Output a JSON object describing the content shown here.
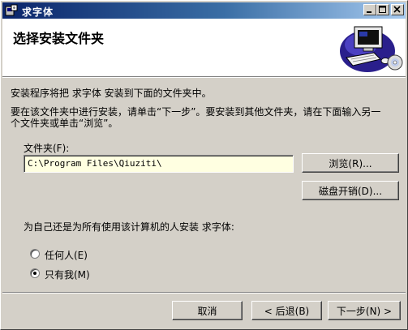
{
  "window": {
    "title": "求字体",
    "icons": {
      "app": "setup-app-icon",
      "minimize": "minimize-icon",
      "maximize": "maximize-icon",
      "close": "close-icon"
    }
  },
  "banner": {
    "title": "选择安装文件夹",
    "image": "computer-with-disc-illustration"
  },
  "body": {
    "intro": "安装程序将把 求字体 安装到下面的文件夹中。",
    "instruction_line1": "要在该文件夹中进行安装，请单击“下一步”。要安装到其他文件夹，请在下面输入另一",
    "instruction_line2": "个文件夹或单击“浏览”。"
  },
  "folder": {
    "label": "文件夹(F):",
    "value": "C:\\Program Files\\Qiuziti\\",
    "browse_button": "浏览(R)...",
    "disk_cost_button": "磁盘开销(D)..."
  },
  "install_for": {
    "question": "为自己还是为所有使用该计算机的人安装 求字体:",
    "options": [
      {
        "label": "任何人(E)",
        "selected": false
      },
      {
        "label": "只有我(M)",
        "selected": true
      }
    ]
  },
  "footer": {
    "cancel": "取消",
    "back": "< 后退(B)",
    "next": "下一步(N) >"
  }
}
